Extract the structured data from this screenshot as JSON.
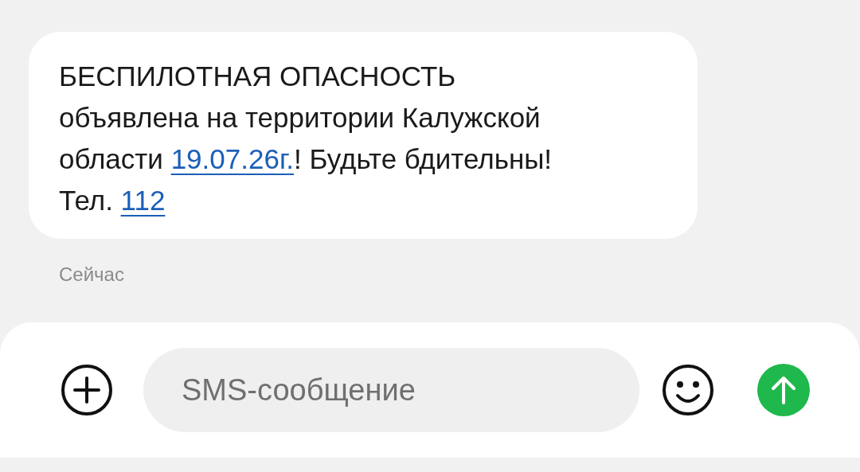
{
  "message": {
    "lines": [
      [
        {
          "kind": "text",
          "text": "БЕСПИЛОТНАЯ ОПАСНОСТЬ"
        }
      ],
      [
        {
          "kind": "text",
          "text": "объявлена на территории Калужской"
        }
      ],
      [
        {
          "kind": "text",
          "text": "области "
        },
        {
          "kind": "link",
          "text": "19.07.26г."
        },
        {
          "kind": "text",
          "text": "! Будьте бдительны!"
        }
      ],
      [
        {
          "kind": "text",
          "text": "Тел. "
        },
        {
          "kind": "link",
          "text": "112"
        }
      ]
    ],
    "time": "Сейчас"
  },
  "composer": {
    "placeholder": "SMS-сообщение"
  }
}
